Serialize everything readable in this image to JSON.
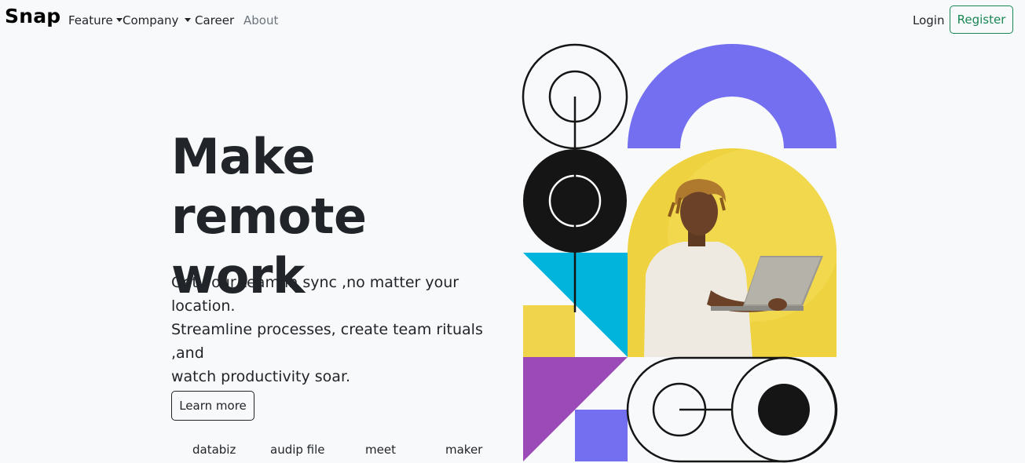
{
  "navbar": {
    "brand": "Snap",
    "links": [
      {
        "label": "Feature"
      },
      {
        "label": "Company"
      },
      {
        "label": "Career"
      },
      {
        "label": "About"
      }
    ],
    "login_label": "Login",
    "register_label": "Register"
  },
  "hero": {
    "title_line1": "Make remote",
    "title_line2": "work",
    "description_line1": "Get your team in sync ,no matter your location.",
    "description_line2": "Streamline processes, create team rituals ,and",
    "description_line3": "watch productivity soar.",
    "learn_more_label": "Learn more"
  },
  "partners": [
    "databiz",
    "audip file",
    "meet",
    "maker"
  ],
  "colors": {
    "brand_green": "#198754",
    "purple": "#736ff0",
    "yellow": "#f0d44b",
    "cyan": "#00b4dc",
    "violet": "#9b4ab7",
    "dark": "#151515"
  }
}
